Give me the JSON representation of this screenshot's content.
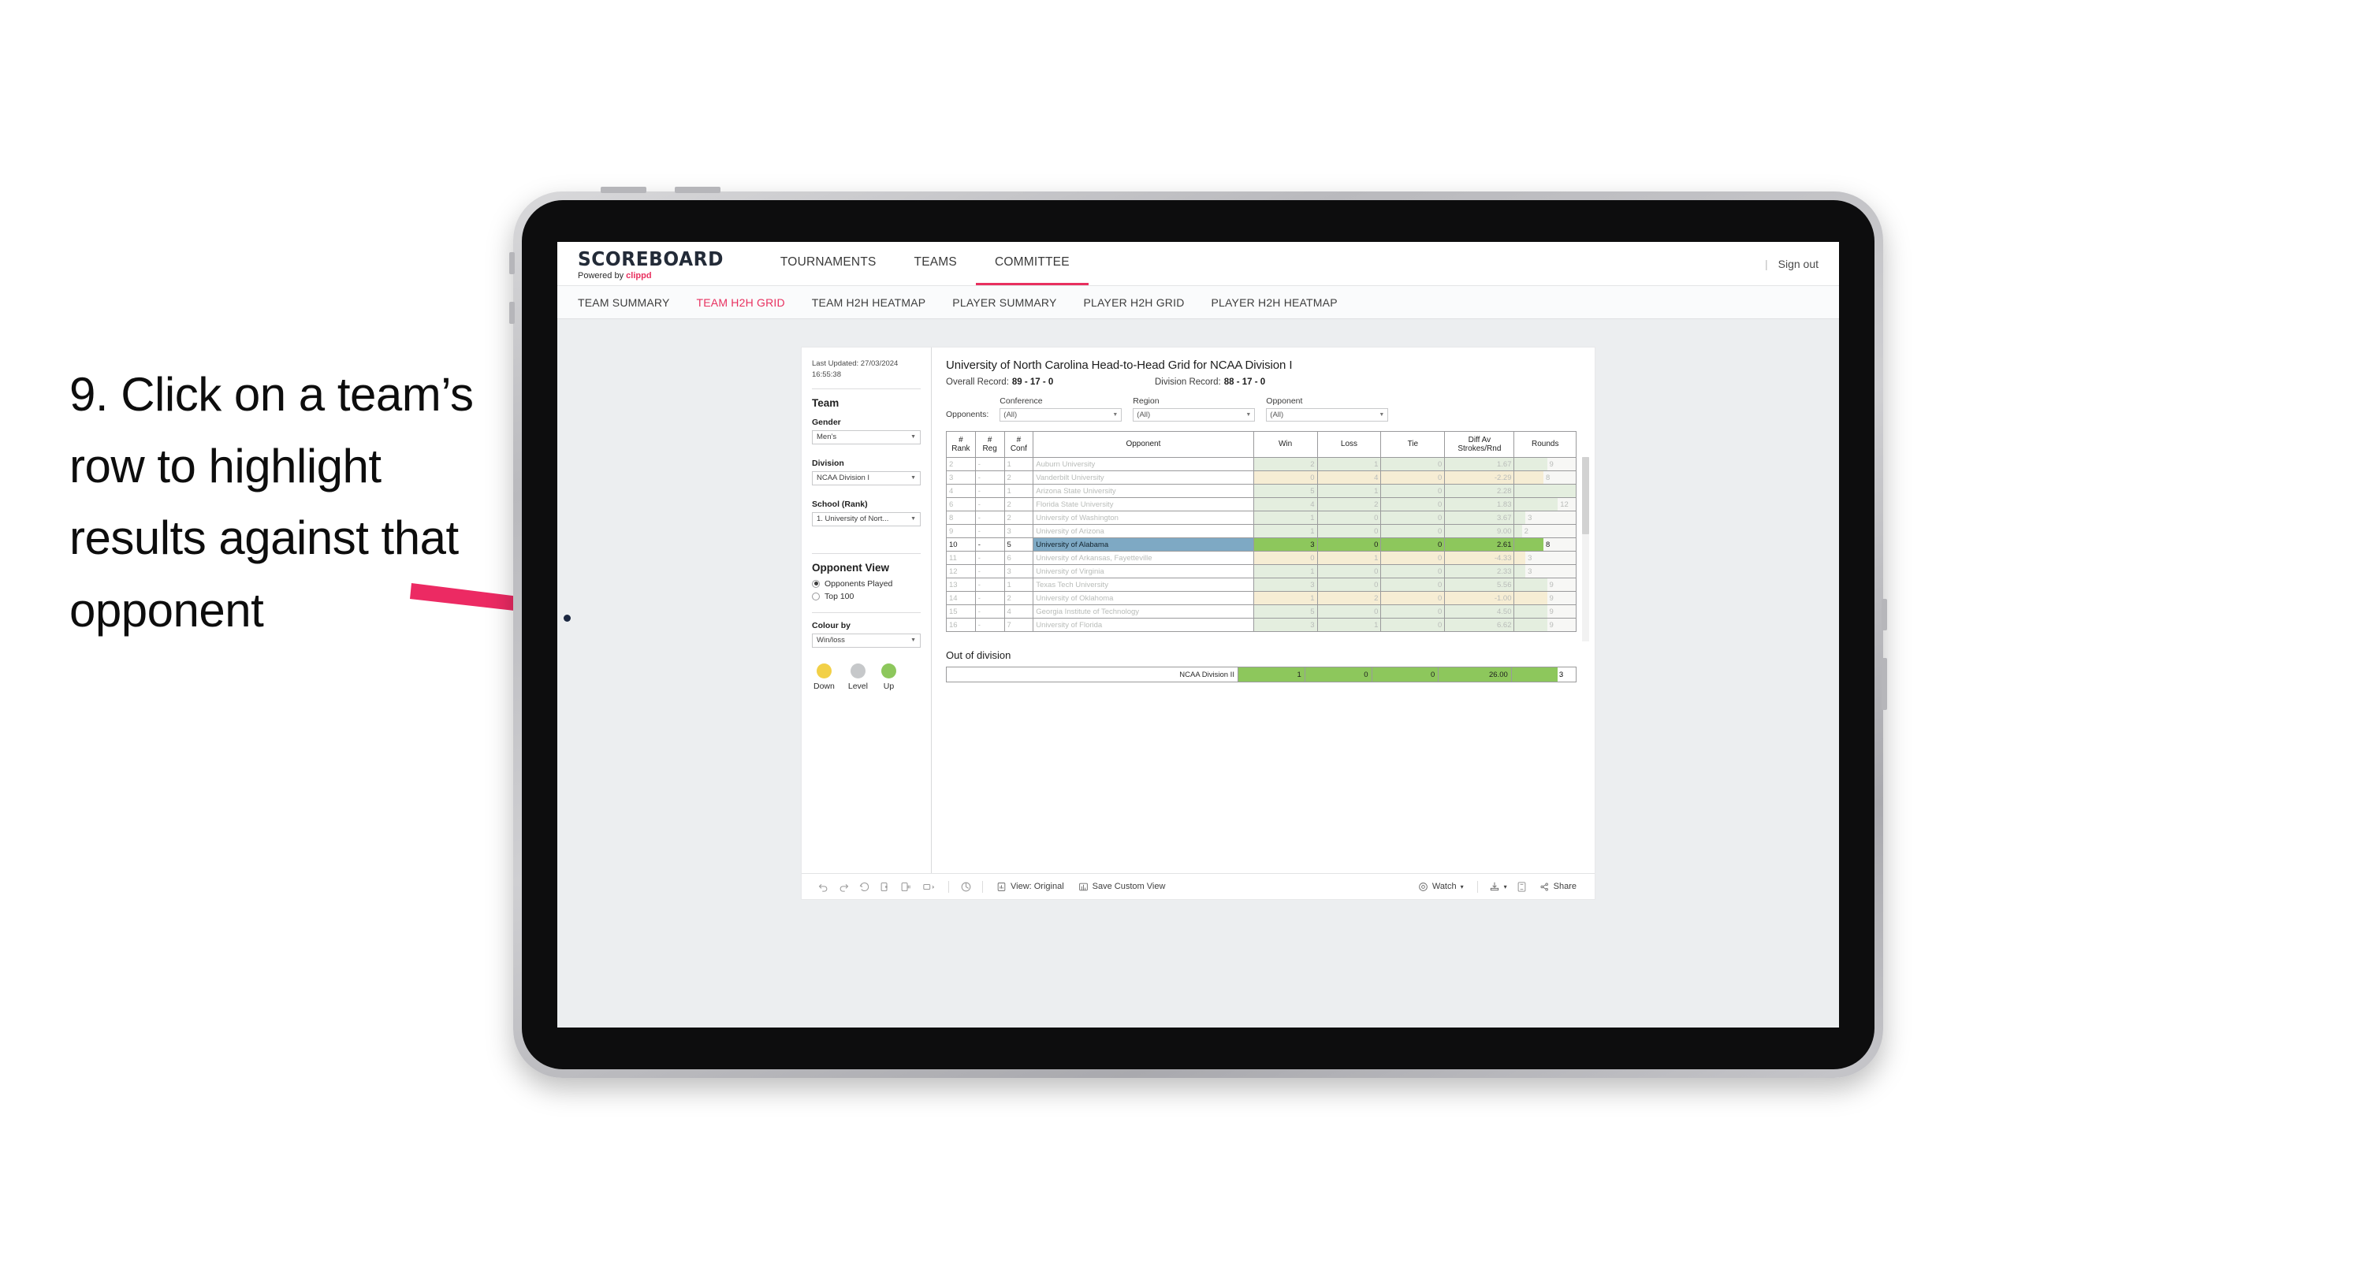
{
  "instruction": {
    "text": "9. Click on a team’s row to highlight results against that opponent"
  },
  "app": {
    "brand": {
      "title": "SCOREBOARD",
      "powered_prefix": "Powered by ",
      "powered_name": "clippd"
    },
    "topnav": [
      {
        "label": "TOURNAMENTS",
        "active": false
      },
      {
        "label": "TEAMS",
        "active": false
      },
      {
        "label": "COMMITTEE",
        "active": true
      }
    ],
    "topbar_right": {
      "divider": "|",
      "sign_out": "Sign out"
    },
    "subnav": [
      {
        "label": "TEAM SUMMARY",
        "active": false
      },
      {
        "label": "TEAM H2H GRID",
        "active": true
      },
      {
        "label": "TEAM H2H HEATMAP",
        "active": false
      },
      {
        "label": "PLAYER SUMMARY",
        "active": false
      },
      {
        "label": "PLAYER H2H GRID",
        "active": false
      },
      {
        "label": "PLAYER H2H HEATMAP",
        "active": false
      }
    ],
    "accent_color": "#e8305f"
  },
  "sidebar": {
    "last_updated": "Last Updated: 27/03/2024 16:55:38",
    "team_heading": "Team",
    "gender": {
      "label": "Gender",
      "value": "Men’s"
    },
    "division": {
      "label": "Division",
      "value": "NCAA Division I"
    },
    "school": {
      "label": "School (Rank)",
      "value": "1. University of Nort..."
    },
    "opponent_view": {
      "heading": "Opponent View",
      "options": [
        {
          "label": "Opponents Played",
          "selected": true
        },
        {
          "label": "Top 100",
          "selected": false
        }
      ]
    },
    "colour_by": {
      "label": "Colour by",
      "value": "Win/loss"
    },
    "legend": [
      {
        "label": "Down",
        "color": "#f2d047"
      },
      {
        "label": "Level",
        "color": "#c6c8ca"
      },
      {
        "label": "Up",
        "color": "#8dc75c"
      }
    ]
  },
  "main": {
    "title": "University of North Carolina Head-to-Head Grid for NCAA Division I",
    "overall_record": {
      "label": "Overall Record:",
      "value": "89 - 17 - 0"
    },
    "division_record": {
      "label": "Division Record:",
      "value": "88 - 17 - 0"
    },
    "opponents_word": "Opponents:",
    "filters": [
      {
        "label": "Conference",
        "value": "(All)"
      },
      {
        "label": "Region",
        "value": "(All)"
      },
      {
        "label": "Opponent",
        "value": "(All)"
      }
    ],
    "out_of_division_title": "Out of division"
  },
  "chart_data": {
    "type": "table",
    "title": "University of North Carolina Head-to-Head Grid for NCAA Division I",
    "columns": [
      "# Rank",
      "# Reg",
      "# Conf",
      "Opponent",
      "Win",
      "Loss",
      "Tie",
      "Diff Av Strokes/Rnd",
      "Rounds"
    ],
    "column_header_lines": [
      [
        "#",
        "Rank"
      ],
      [
        "#",
        "Reg"
      ],
      [
        "#",
        "Conf"
      ],
      [
        "Opponent"
      ],
      [
        "Win"
      ],
      [
        "Loss"
      ],
      [
        "Tie"
      ],
      [
        "Diff Av",
        "Strokes/Rnd"
      ],
      [
        "Rounds"
      ]
    ],
    "rounds_max": 17,
    "rows": [
      {
        "rank": "2",
        "reg": "-",
        "conf": "1",
        "opponent": "Auburn University",
        "win": "2",
        "loss": "1",
        "tie": "0",
        "diff": "1.67",
        "rounds": "9",
        "tone": "up",
        "selected": false
      },
      {
        "rank": "3",
        "reg": "-",
        "conf": "2",
        "opponent": "Vanderbilt University",
        "win": "0",
        "loss": "4",
        "tie": "0",
        "diff": "-2.29",
        "rounds": "8",
        "tone": "down",
        "selected": false
      },
      {
        "rank": "4",
        "reg": "-",
        "conf": "1",
        "opponent": "Arizona State University",
        "win": "5",
        "loss": "1",
        "tie": "0",
        "diff": "2.28",
        "rounds": "17",
        "tone": "up",
        "selected": false
      },
      {
        "rank": "6",
        "reg": "-",
        "conf": "2",
        "opponent": "Florida State University",
        "win": "4",
        "loss": "2",
        "tie": "0",
        "diff": "1.83",
        "rounds": "12",
        "tone": "up",
        "selected": false
      },
      {
        "rank": "8",
        "reg": "-",
        "conf": "2",
        "opponent": "University of Washington",
        "win": "1",
        "loss": "0",
        "tie": "0",
        "diff": "3.67",
        "rounds": "3",
        "tone": "up",
        "selected": false
      },
      {
        "rank": "9",
        "reg": "-",
        "conf": "3",
        "opponent": "University of Arizona",
        "win": "1",
        "loss": "0",
        "tie": "0",
        "diff": "9.00",
        "rounds": "2",
        "tone": "up",
        "selected": false
      },
      {
        "rank": "10",
        "reg": "-",
        "conf": "5",
        "opponent": "University of Alabama",
        "win": "3",
        "loss": "0",
        "tie": "0",
        "diff": "2.61",
        "rounds": "8",
        "tone": "up",
        "selected": true
      },
      {
        "rank": "11",
        "reg": "-",
        "conf": "6",
        "opponent": "University of Arkansas, Fayetteville",
        "win": "0",
        "loss": "1",
        "tie": "0",
        "diff": "-4.33",
        "rounds": "3",
        "tone": "down",
        "selected": false
      },
      {
        "rank": "12",
        "reg": "-",
        "conf": "3",
        "opponent": "University of Virginia",
        "win": "1",
        "loss": "0",
        "tie": "0",
        "diff": "2.33",
        "rounds": "3",
        "tone": "up",
        "selected": false
      },
      {
        "rank": "13",
        "reg": "-",
        "conf": "1",
        "opponent": "Texas Tech University",
        "win": "3",
        "loss": "0",
        "tie": "0",
        "diff": "5.56",
        "rounds": "9",
        "tone": "up",
        "selected": false
      },
      {
        "rank": "14",
        "reg": "-",
        "conf": "2",
        "opponent": "University of Oklahoma",
        "win": "1",
        "loss": "2",
        "tie": "0",
        "diff": "-1.00",
        "rounds": "9",
        "tone": "down",
        "selected": false
      },
      {
        "rank": "15",
        "reg": "-",
        "conf": "4",
        "opponent": "Georgia Institute of Technology",
        "win": "5",
        "loss": "0",
        "tie": "0",
        "diff": "4.50",
        "rounds": "9",
        "tone": "up",
        "selected": false
      },
      {
        "rank": "16",
        "reg": "-",
        "conf": "7",
        "opponent": "University of Florida",
        "win": "3",
        "loss": "1",
        "tie": "0",
        "diff": "6.62",
        "rounds": "9",
        "tone": "up",
        "selected": false
      }
    ],
    "out_of_division": {
      "label": "NCAA Division II",
      "win": "1",
      "loss": "0",
      "tie": "0",
      "diff": "26.00",
      "rounds": "3"
    }
  },
  "toolbar": {
    "view_original": "View: Original",
    "save_custom_view": "Save Custom View",
    "watch": "Watch",
    "share": "Share",
    "caret": "▾"
  }
}
